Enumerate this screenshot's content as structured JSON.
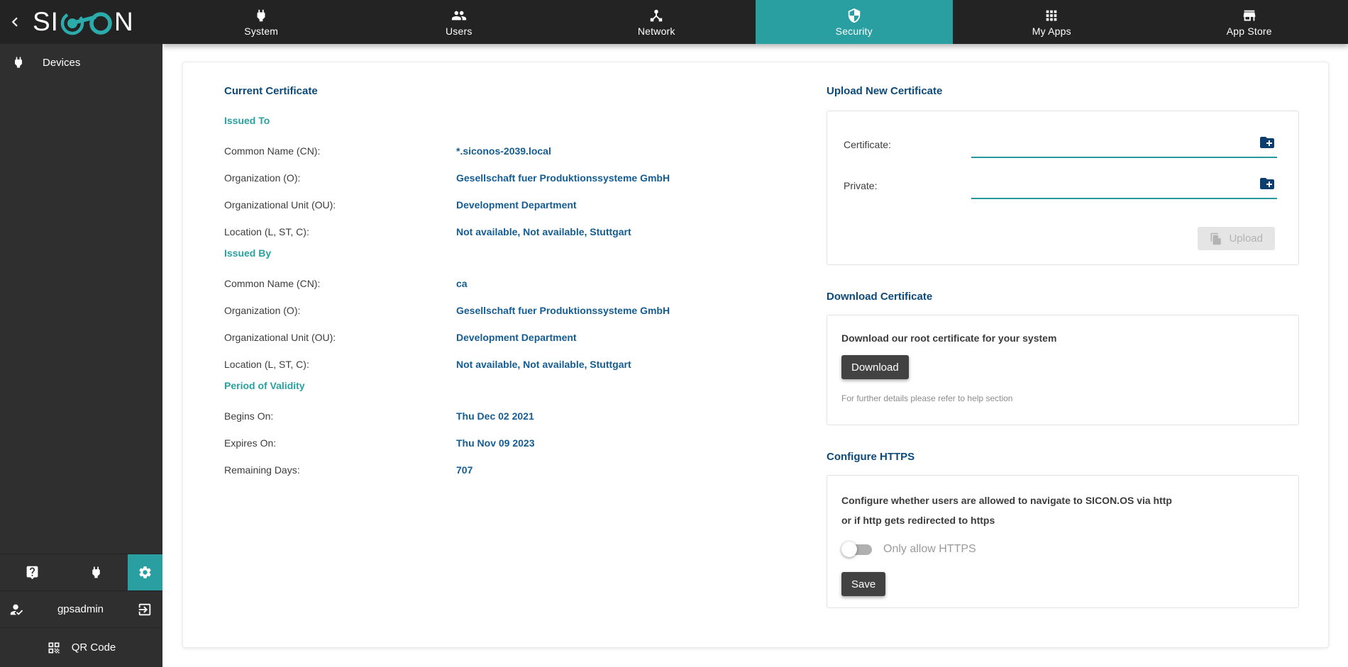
{
  "brand": {
    "logo_prefix": "SI",
    "logo_suffix": "N"
  },
  "nav": {
    "tabs": [
      {
        "label": "System"
      },
      {
        "label": "Users"
      },
      {
        "label": "Network"
      },
      {
        "label": "Security"
      },
      {
        "label": "My Apps"
      },
      {
        "label": "App Store"
      }
    ]
  },
  "sidebar": {
    "items": [
      {
        "label": "Devices"
      }
    ],
    "user_name": "gpsadmin",
    "qr_label": "QR Code"
  },
  "current_certificate": {
    "title": "Current Certificate",
    "sections": [
      {
        "title": "Issued To",
        "fields": [
          {
            "label": "Common Name (CN):",
            "value": "*.siconos-2039.local"
          },
          {
            "label": "Organization (O):",
            "value": "Gesellschaft fuer Produktionssysteme GmbH"
          },
          {
            "label": "Organizational Unit (OU):",
            "value": "Development Department"
          },
          {
            "label": "Location (L, ST, C):",
            "value": "Not available, Not available, Stuttgart"
          }
        ]
      },
      {
        "title": "Issued By",
        "fields": [
          {
            "label": "Common Name (CN):",
            "value": "ca"
          },
          {
            "label": "Organization (O):",
            "value": "Gesellschaft fuer Produktionssysteme GmbH"
          },
          {
            "label": "Organizational Unit (OU):",
            "value": "Development Department"
          },
          {
            "label": "Location (L, ST, C):",
            "value": "Not available, Not available, Stuttgart"
          }
        ]
      },
      {
        "title": "Period of Validity",
        "fields": [
          {
            "label": "Begins On:",
            "value": "Thu Dec 02 2021"
          },
          {
            "label": "Expires On:",
            "value": "Thu Nov 09 2023"
          },
          {
            "label": "Remaining Days:",
            "value": "707"
          }
        ]
      }
    ]
  },
  "upload": {
    "title": "Upload New Certificate",
    "certificate_label": "Certificate:",
    "private_label": "Private:",
    "certificate_value": "",
    "private_value": "",
    "button": "Upload"
  },
  "download": {
    "title": "Download Certificate",
    "description": "Download our root certificate for your system",
    "button": "Download",
    "note": "For further details please refer to help section"
  },
  "https": {
    "title": "Configure HTTPS",
    "description_line1": "Configure whether users are allowed to navigate to SICON.OS via http",
    "description_line2": "or if http gets redirected to https",
    "toggle_label": "Only allow HTTPS",
    "toggle_state": "off",
    "button": "Save"
  },
  "colors": {
    "accent_teal": "#2a9fa2",
    "heading_blue": "#0d4a7a",
    "value_blue": "#145c92",
    "topbar_dark": "#232323",
    "sidebar_dark": "#2f2f2f",
    "button_dark": "#424242"
  }
}
